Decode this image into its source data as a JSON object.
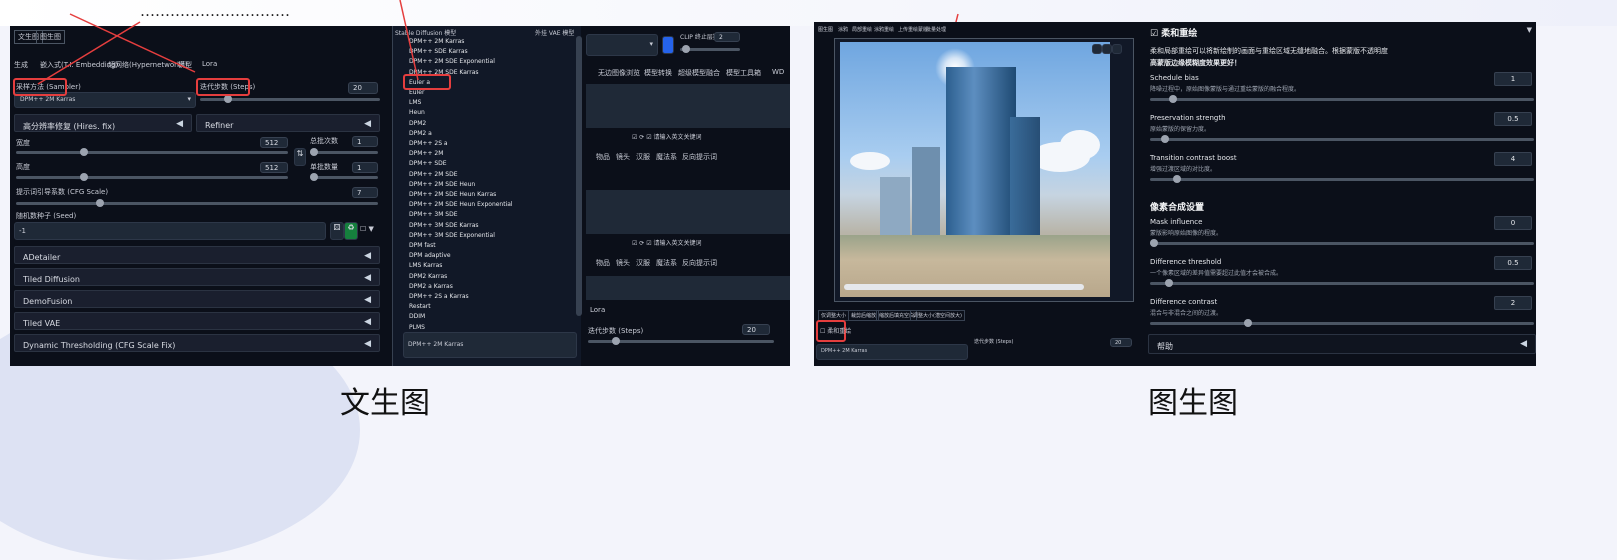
{
  "page": {
    "top_text": "…………………………",
    "left_caption": "文生图",
    "right_caption": "图生图"
  },
  "txt2img": {
    "tabs_top": [
      "文生图",
      "图生图"
    ],
    "subtabs": [
      "生成",
      "嵌入式(T.I. Embedding)",
      "超网络(Hypernetworks)",
      "模型",
      "Lora"
    ],
    "sampler_label": "采样方法 (Sampler)",
    "sampler_value": "DPM++ 2M Karras",
    "steps_label": "迭代步数 (Steps)",
    "steps_value": "20",
    "hires_label": "高分辨率修复 (Hires. fix)",
    "refiner_label": "Refiner",
    "width_label": "宽度",
    "width_value": "512",
    "height_label": "高度",
    "height_value": "512",
    "batch_count_label": "总批次数",
    "batch_count_value": "1",
    "batch_size_label": "单批数量",
    "batch_size_value": "1",
    "cfg_label": "提示词引导系数 (CFG Scale)",
    "cfg_value": "7",
    "seed_label": "随机数种子 (Seed)",
    "seed_value": "-1",
    "accordions": [
      "ADetailer",
      "Tiled Diffusion",
      "DemoFusion",
      "Tiled VAE",
      "Dynamic Thresholding (CFG Scale Fix)"
    ],
    "model_label": "Stable Diffusion 模型",
    "vae_label": "外挂 VAE 模型",
    "clip_label": "CLIP 终止层数",
    "clip_value": "2",
    "sampler_options": [
      "DPM++ 2M Karras",
      "DPM++ SDE Karras",
      "DPM++ 2M SDE Exponential",
      "DPM++ 2M SDE Karras",
      "Euler a",
      "Euler",
      "LMS",
      "Heun",
      "DPM2",
      "DPM2 a",
      "DPM++ 2S a",
      "DPM++ 2M",
      "DPM++ SDE",
      "DPM++ 2M SDE",
      "DPM++ 2M SDE Heun",
      "DPM++ 2M SDE Heun Karras",
      "DPM++ 2M SDE Heun Exponential",
      "DPM++ 3M SDE",
      "DPM++ 3M SDE Karras",
      "DPM++ 3M SDE Exponential",
      "DPM fast",
      "DPM adaptive",
      "LMS Karras",
      "DPM2 Karras",
      "DPM2 a Karras",
      "DPM++ 2S a Karras",
      "Restart",
      "DDIM",
      "PLMS"
    ],
    "dropdown_current": "DPM++ 2M Karras",
    "right_tabs": [
      "无边图像浏览",
      "模型转换",
      "超级模型融合",
      "模型工具箱",
      "WD"
    ],
    "keyword_placeholder": "请输入英文关键词",
    "tag_tabs": [
      "物品",
      "镜头",
      "汉服",
      "魔法系",
      "反向提示词"
    ],
    "lora_label": "Lora",
    "steps_label_2": "迭代步数 (Steps)",
    "steps_value_2": "20"
  },
  "img2img": {
    "top_tabs": [
      "图生图",
      "涂鸦",
      "局部重绘",
      "涂鸦重绘",
      "上传重绘蒙版",
      "批量处理"
    ],
    "resize_options": [
      "仅调整大小",
      "裁剪后缩放",
      "缩放后填充空白",
      "调整大小(潜空间放大)"
    ],
    "soft_inpaint_label": "柔和重绘",
    "sampler_value": "DPM++ 2M Karras",
    "steps_label": "迭代步数 (Steps)",
    "steps_value": "20",
    "panel_title": "柔和重绘",
    "panel_intro": "柔和局部重绘可以将新绘制的画面与重绘区域无缝地融合。根据蒙版不透明度",
    "panel_intro2": "高蒙版边缘模糊度效果更好！",
    "params": [
      {
        "label": "Schedule bias",
        "desc": "降噪过程中，原始图像蒙版与通过重绘蒙版的融合程度。",
        "value": "1",
        "fill": 0.05
      },
      {
        "label": "Preservation strength",
        "desc": "原始蒙版的保留力度。",
        "value": "0.5",
        "fill": 0.03
      },
      {
        "label": "Transition contrast boost",
        "desc": "增强过渡区域的对比度。",
        "value": "4",
        "fill": 0.06
      }
    ],
    "composite_title": "像素合成设置",
    "composite_params": [
      {
        "label": "Mask influence",
        "desc": "蒙版影响原始图像的程度。",
        "value": "0",
        "fill": 0.0
      },
      {
        "label": "Difference threshold",
        "desc": "一个像素区域的差异值需要超过此值才会被合成。",
        "value": "0.5",
        "fill": 0.04
      },
      {
        "label": "Difference contrast",
        "desc": "混合与非混合之间的过渡。",
        "value": "2",
        "fill": 0.25
      }
    ],
    "help_label": "帮助"
  },
  "colors": {
    "panel_bg": "#0b0f19",
    "highlight": "#e53e3e",
    "accent": "#2563eb"
  }
}
